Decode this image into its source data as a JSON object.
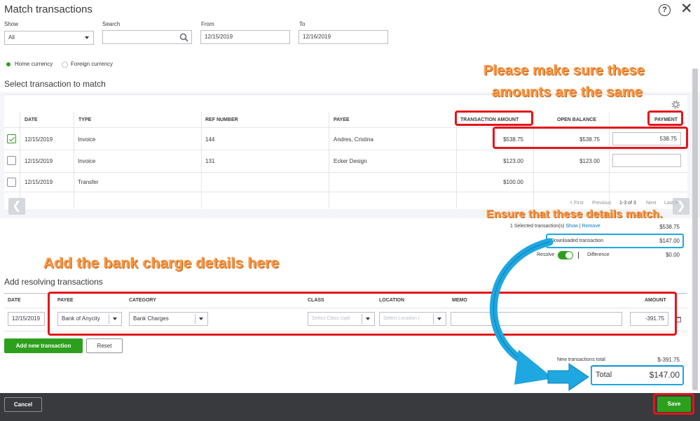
{
  "dialog": {
    "title": "Match transactions"
  },
  "filters": {
    "show_label": "Show",
    "show_value": "All",
    "search_label": "Search",
    "search_value": "",
    "from_label": "From",
    "from_value": "12/15/2019",
    "to_label": "To",
    "to_value": "12/16/2019"
  },
  "currency": {
    "home": "Home currency",
    "foreign": "Foreign currency"
  },
  "match": {
    "section_title": "Select transaction to match",
    "columns": [
      "DATE",
      "TYPE",
      "REF NUMBER",
      "PAYEE",
      "TRANSACTION AMOUNT",
      "OPEN BALANCE",
      "PAYMENT"
    ],
    "rows": [
      {
        "checked": true,
        "date": "12/15/2019",
        "type": "Invoice",
        "ref": "144",
        "payee": "Andres, Cristina",
        "amount": "$538.75",
        "open_balance": "$538.75",
        "payment": "538.75"
      },
      {
        "checked": false,
        "date": "12/15/2019",
        "type": "Invoice",
        "ref": "131",
        "payee": "Ecker Design",
        "amount": "$123.00",
        "open_balance": "$123.00",
        "payment": ""
      },
      {
        "checked": false,
        "date": "12/15/2019",
        "type": "Transfer",
        "ref": "",
        "payee": "",
        "amount": "$100.00",
        "open_balance": "",
        "payment": ""
      }
    ],
    "pagination": {
      "first": "< First",
      "previous": "Previous",
      "range": "1-3 of 3",
      "next": "Next",
      "last": "Last >"
    }
  },
  "summary": {
    "selected_text": "1 Selected transaction(s)",
    "show_link": "Show",
    "separator": "|",
    "remove_link": "Remove",
    "selected_amount": "$538.75",
    "downloaded_label": "Downloaded transaction",
    "downloaded_amount": "$147.00",
    "resolve_label": "Resolve",
    "difference_label": "Difference",
    "difference_amount": "$0.00"
  },
  "resolving": {
    "section_title": "Add resolving transactions",
    "columns": [
      "DATE",
      "PAYEE",
      "CATEGORY",
      "CLASS",
      "LOCATION",
      "MEMO",
      "AMOUNT"
    ],
    "row": {
      "date": "12/15/2019",
      "payee": "Bank of Anycity",
      "category": "Bank Charges",
      "class_placeholder": "Select Class (opti",
      "location_placeholder": "Select Location (",
      "memo": "",
      "amount": "-391.75"
    },
    "add_button": "Add new transaction",
    "reset_button": "Reset"
  },
  "totals": {
    "new_total_label": "New transactions total",
    "new_total_value": "$-391.75",
    "total_label": "Total",
    "total_value": "$147.00"
  },
  "footer": {
    "cancel": "Cancel",
    "save": "Save"
  },
  "annotations": {
    "amounts_same_1": "Please make sure these",
    "amounts_same_2": "amounts are the same",
    "details_match": "Ensure that these details match.",
    "bank_charge": "Add the bank charge details here"
  },
  "colors": {
    "accent_green": "#2ca01c",
    "annotation_red": "#e4151b",
    "annotation_blue": "#1ea7e1",
    "annotation_orange": "#f79646"
  }
}
